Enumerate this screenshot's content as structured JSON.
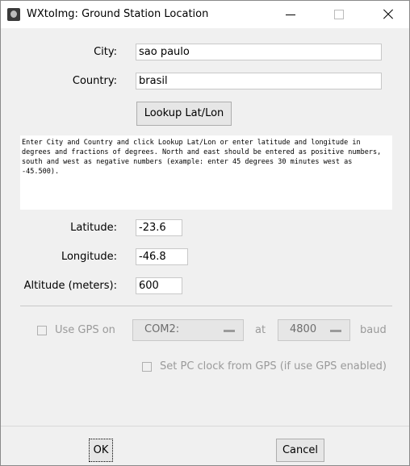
{
  "window": {
    "title": "WXtoImg: Ground Station Location"
  },
  "location": {
    "city_label": "City:",
    "city_value": "sao paulo",
    "country_label": "Country:",
    "country_value": "brasil",
    "lookup_button": "Lookup Lat/Lon"
  },
  "info_text": "Enter City and Country and click Lookup Lat/Lon or enter latitude and longitude in degrees and fractions of degrees.  North and east should be entered as positive numbers, south and west as negative numbers (example: enter 45 degrees 30 minutes west as -45.500).",
  "coords": {
    "latitude_label": "Latitude:",
    "latitude_value": "-23.6",
    "longitude_label": "Longitude:",
    "longitude_value": "-46.8",
    "altitude_label": "Altitude (meters):",
    "altitude_value": "600"
  },
  "gps": {
    "use_gps_label": "Use GPS on",
    "port_value": "COM2:",
    "at_label": "at",
    "baud_value": "4800",
    "baud_label": "baud",
    "set_clock_label": "Set PC clock from GPS (if use GPS enabled)",
    "use_gps_checked": false,
    "set_clock_checked": false
  },
  "buttons": {
    "ok": "OK",
    "cancel": "Cancel"
  }
}
